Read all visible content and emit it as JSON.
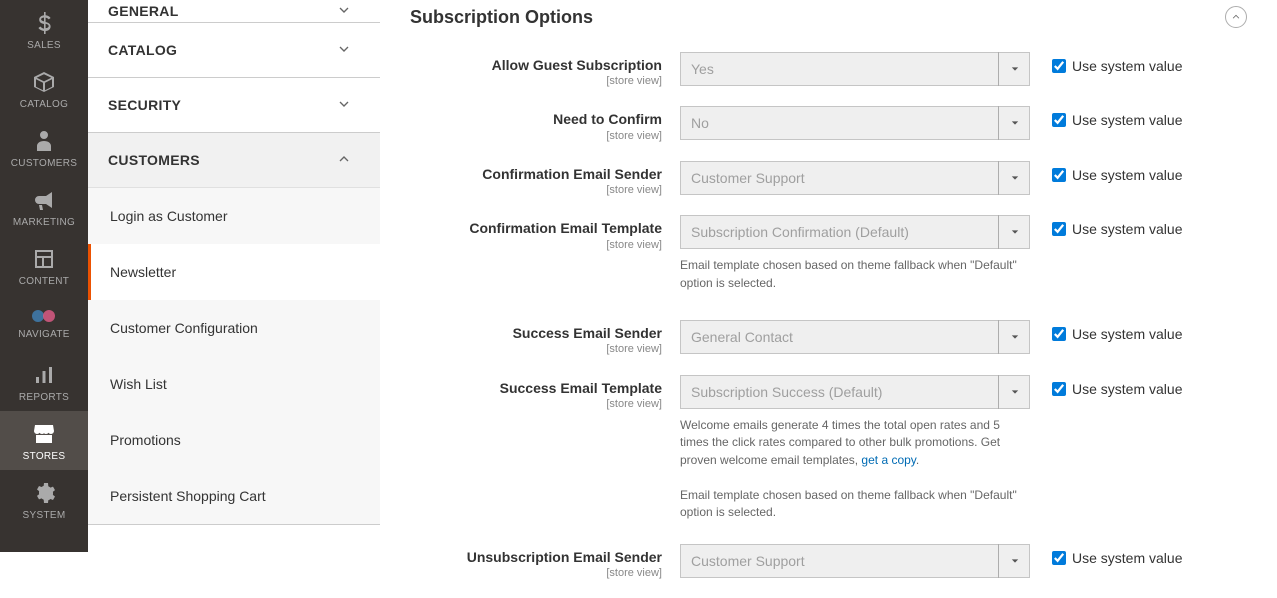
{
  "nav": {
    "sales": "SALES",
    "catalog": "CATALOG",
    "customers": "CUSTOMERS",
    "marketing": "MARKETING",
    "content": "CONTENT",
    "reports": "REPORTS",
    "stores": "STORES",
    "system": "SYSTEM"
  },
  "sidebar": {
    "general": "GENERAL",
    "catalog": "CATALOG",
    "security": "SECURITY",
    "customers": "CUSTOMERS",
    "sub": {
      "login_as_customer": "Login as Customer",
      "newsletter": "Newsletter",
      "customer_configuration": "Customer Configuration",
      "wish_list": "Wish List",
      "promotions": "Promotions",
      "persistent_shopping_cart": "Persistent Shopping Cart"
    }
  },
  "section": {
    "title": "Subscription Options"
  },
  "common": {
    "scope": "[store view]",
    "use_system": "Use system value"
  },
  "fields": {
    "allow_guest": {
      "label": "Allow Guest Subscription",
      "value": "Yes"
    },
    "need_confirm": {
      "label": "Need to Confirm",
      "value": "No"
    },
    "confirm_sender": {
      "label": "Confirmation Email Sender",
      "value": "Customer Support"
    },
    "confirm_template": {
      "label": "Confirmation Email Template",
      "value": "Subscription Confirmation (Default)",
      "note": "Email template chosen based on theme fallback when \"Default\" option is selected."
    },
    "success_sender": {
      "label": "Success Email Sender",
      "value": "General Contact"
    },
    "success_template": {
      "label": "Success Email Template",
      "value": "Subscription Success (Default)",
      "note1_a": "Welcome emails generate 4 times the total open rates and 5 times the click rates compared to other bulk promotions. Get proven welcome email templates, ",
      "note1_link": "get a copy",
      "note1_b": ".",
      "note2": "Email template chosen based on theme fallback when \"Default\" option is selected."
    },
    "unsub_sender": {
      "label": "Unsubscription Email Sender",
      "value": "Customer Support"
    }
  }
}
